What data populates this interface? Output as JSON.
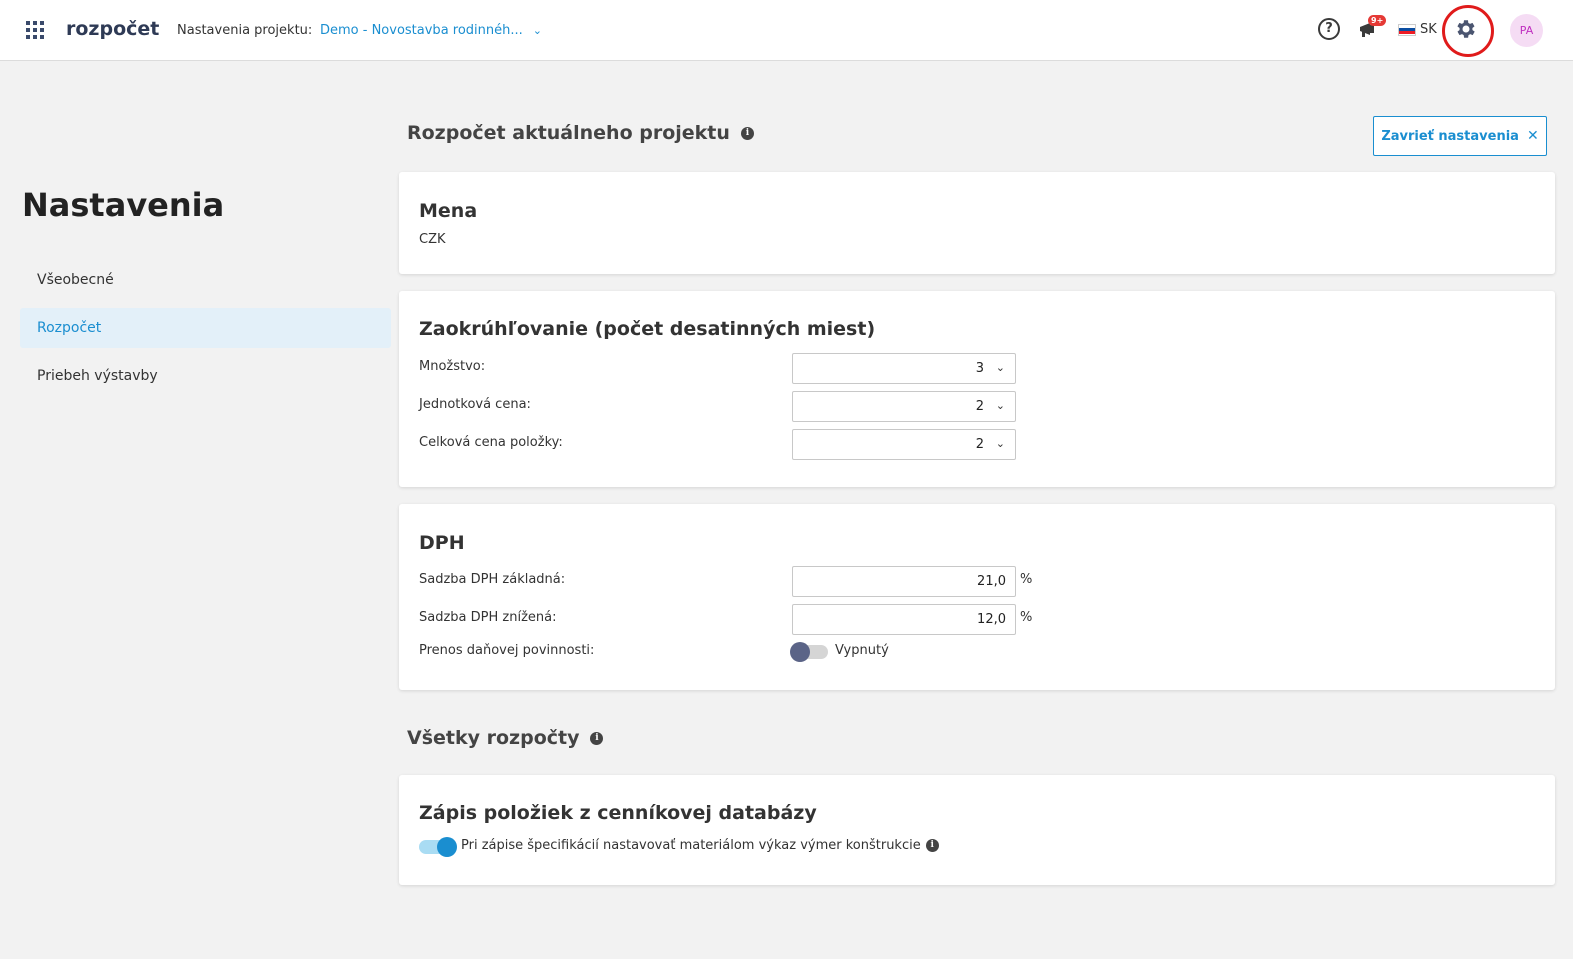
{
  "header": {
    "app_title": "rozpočet",
    "project_label": "Nastavenia projektu:",
    "project_name": "Demo - Novostavba rodinnéh...",
    "notification_badge": "9+",
    "language": "SK",
    "avatar_initials": "PA"
  },
  "sidebar": {
    "heading": "Nastavenia",
    "items": [
      {
        "label": "Všeobecné"
      },
      {
        "label": "Rozpočet"
      },
      {
        "label": "Priebeh výstavby"
      }
    ],
    "active_index": 1
  },
  "main": {
    "current_budget_title": "Rozpočet aktuálneho projektu",
    "close_button": "Zavrieť nastavenia",
    "currency_card": {
      "title": "Mena",
      "value": "CZK"
    },
    "rounding_card": {
      "title": "Zaokrúhľovanie (počet desatinných miest)",
      "rows": [
        {
          "label": "Množstvo:",
          "value": "3"
        },
        {
          "label": "Jednotková cena:",
          "value": "2"
        },
        {
          "label": "Celková cena položky:",
          "value": "2"
        }
      ]
    },
    "vat_card": {
      "title": "DPH",
      "basic_label": "Sadzba DPH základná:",
      "basic_value": "21,0",
      "reduced_label": "Sadzba DPH znížená:",
      "reduced_value": "12,0",
      "unit": "%",
      "reverse_charge_label": "Prenos daňovej povinnosti:",
      "reverse_charge_state": "Vypnutý"
    },
    "all_budgets_title": "Všetky rozpočty",
    "items_card": {
      "title": "Zápis položiek z cenníkovej databázy",
      "toggle_label": "Pri zápise špecifikácií nastavovať materiálom výkaz výmer konštrukcie"
    }
  },
  "colors": {
    "accent": "#1a8ed0",
    "highlight_circle": "#e01b1b",
    "background": "#f2f2f2"
  }
}
